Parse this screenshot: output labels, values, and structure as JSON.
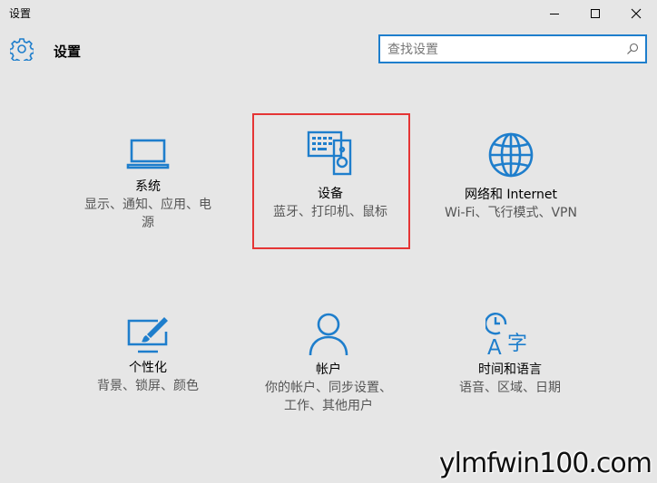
{
  "window": {
    "title": "设置",
    "minimize_icon": "minimize-icon",
    "maximize_icon": "maximize-icon",
    "close_icon": "close-icon"
  },
  "header": {
    "icon": "gear-icon",
    "title": "设置",
    "search_placeholder": "查找设置",
    "search_icon": "search-icon"
  },
  "accent_color": "#1e7ecc",
  "highlight_color": "#e53535",
  "tiles": [
    {
      "icon": "laptop-icon",
      "name": "系统",
      "desc": "显示、通知、应用、电源"
    },
    {
      "icon": "devices-icon",
      "name": "设备",
      "desc": "蓝牙、打印机、鼠标"
    },
    {
      "icon": "globe-icon",
      "name": "网络和 Internet",
      "desc": "Wi-Fi、飞行模式、VPN"
    },
    {
      "icon": "personalization-icon",
      "name": "个性化",
      "desc": "背景、锁屏、颜色"
    },
    {
      "icon": "person-icon",
      "name": "帐户",
      "desc": "你的帐户、同步设置、工作、其他用户"
    },
    {
      "icon": "time-language-icon",
      "name": "时间和语言",
      "desc": "语音、区域、日期"
    }
  ],
  "watermark": "ylmfwin100.com"
}
